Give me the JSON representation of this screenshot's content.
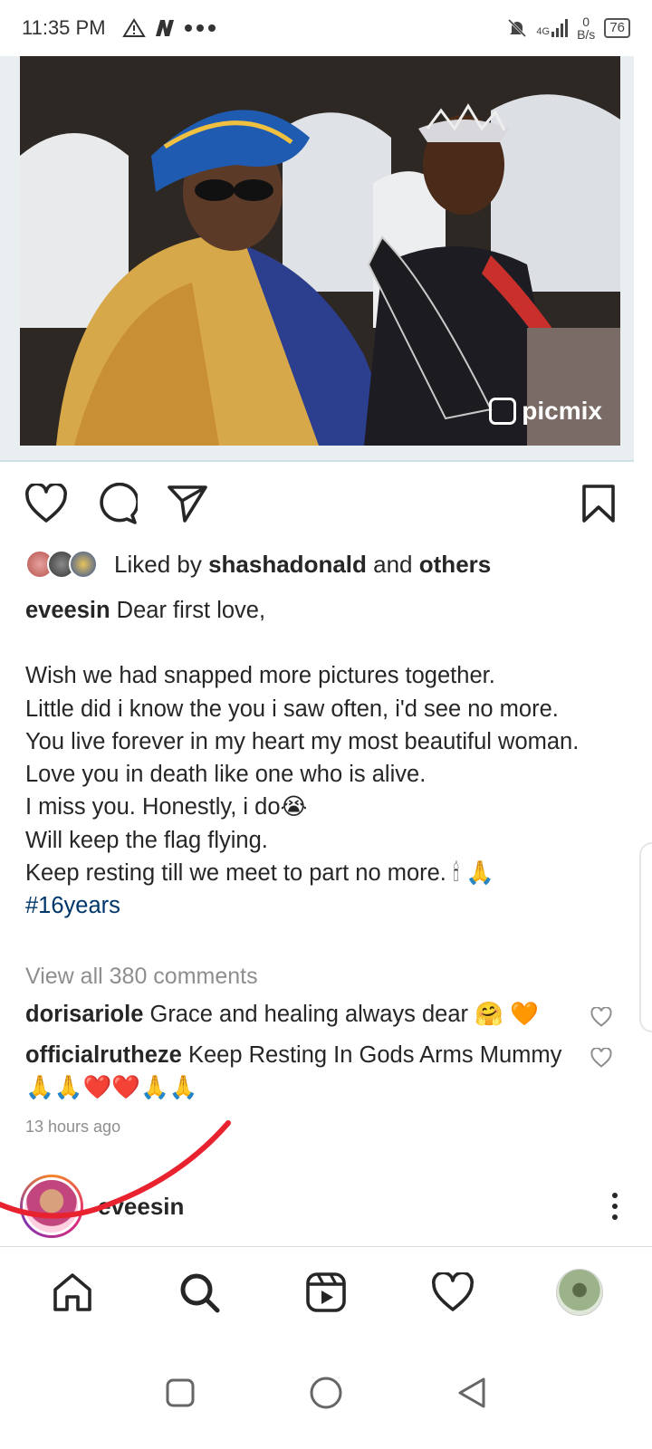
{
  "status_bar": {
    "time": "11:35 PM",
    "network": "4G",
    "speed_value": "0",
    "speed_unit": "B/s",
    "battery": "76"
  },
  "post": {
    "image_watermark": "picmix",
    "likes": {
      "prefix": "Liked by",
      "user": "shashadonald",
      "joiner": "and",
      "others": "others"
    },
    "caption": {
      "user": "eveesin",
      "first_line": "Dear first love,",
      "lines": [
        "Wish we had snapped more pictures together.",
        "Little did i know the you i saw often, i'd see no more.",
        "You live forever in my heart my most beautiful woman.",
        "Love you in death like one who is alive.",
        "I miss you. Honestly, i do😭",
        "Will keep the flag flying.",
        "Keep resting till we meet to part no more. 🕯 🙏"
      ],
      "hashtag": "#16years"
    },
    "view_all_comments": "View all 380 comments",
    "comments": [
      {
        "user": "dorisariole",
        "text": "Grace and healing always dear 🤗 🧡"
      },
      {
        "user": "officialrutheze",
        "text": "Keep Resting In Gods Arms Mummy 🙏🙏❤️❤️🙏🙏"
      }
    ],
    "time_ago": "13 hours ago"
  },
  "next_post": {
    "username": "eveesin"
  },
  "colors": {
    "hashtag": "#00376b",
    "muted": "#8e8e8e",
    "annotation": "#e8232f"
  },
  "icons": [
    "heart-icon",
    "comment-icon",
    "share-icon",
    "bookmark-icon",
    "home-icon",
    "search-icon",
    "reels-icon",
    "activity-icon"
  ]
}
